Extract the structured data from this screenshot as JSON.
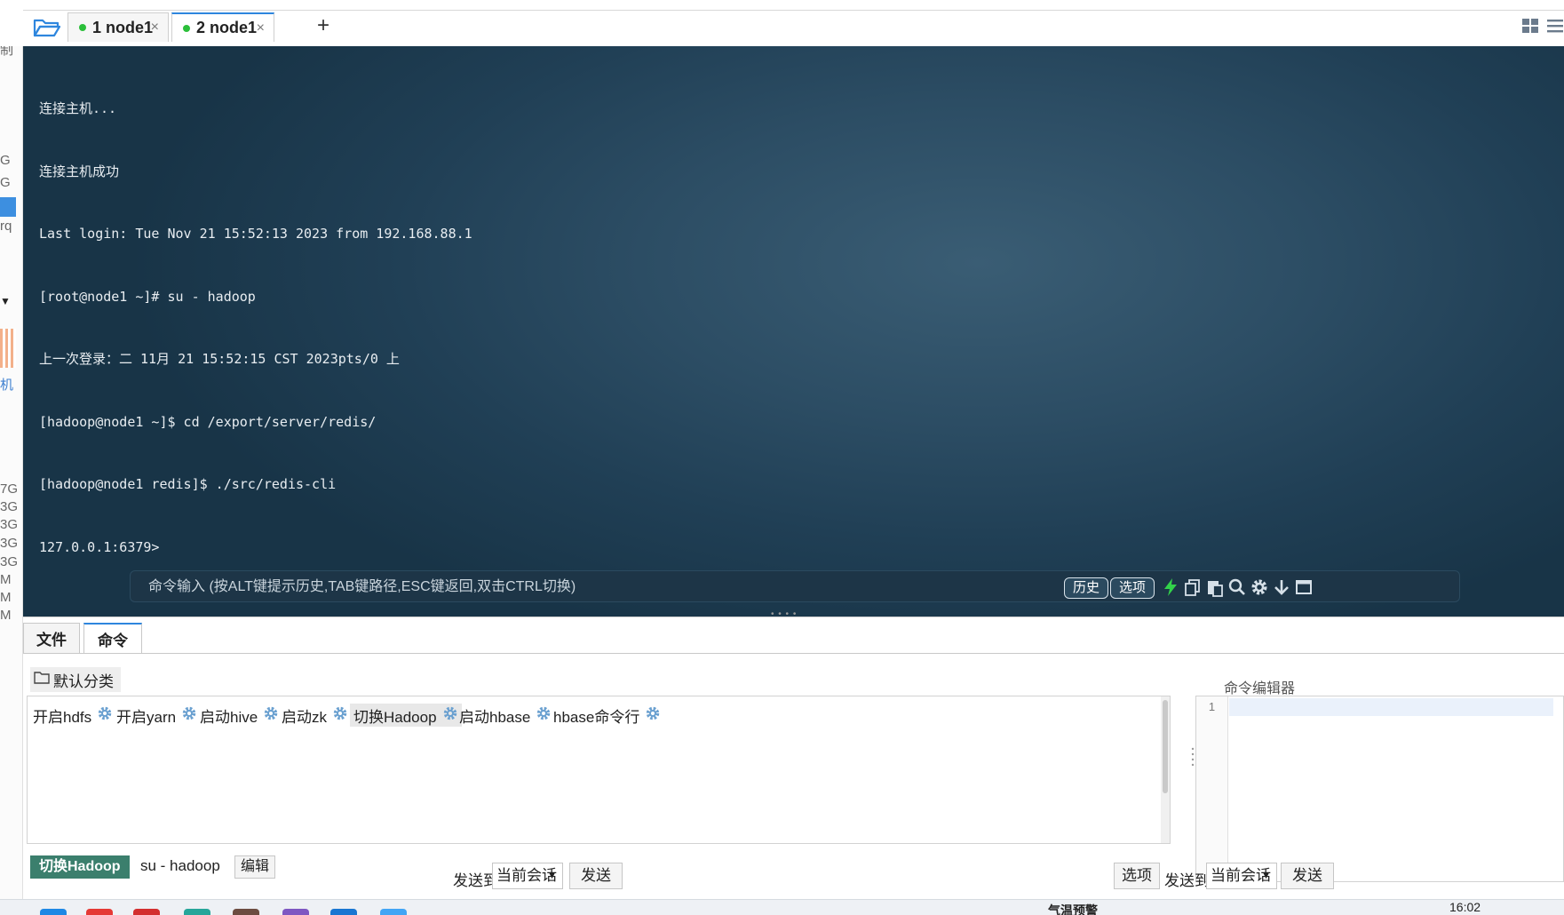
{
  "tabs": [
    {
      "label": "1 node1",
      "status_color": "#2bbf3a"
    },
    {
      "label": "2 node1",
      "status_color": "#2bbf3a"
    }
  ],
  "tab_close": "×",
  "add_tab": "+",
  "left_fragments": [
    "制",
    "G",
    "G",
    "rq",
    "机",
    "7G",
    "3G",
    "3G",
    "3G",
    "3G",
    "M",
    "M",
    "M"
  ],
  "terminal": {
    "lines": [
      "连接主机...",
      "连接主机成功",
      "Last login: Tue Nov 21 15:52:13 2023 from 192.168.88.1",
      "[root@node1 ~]# su - hadoop",
      "上一次登录：二 11月 21 15:52:15 CST 2023pts/0 上",
      "[hadoop@node1 ~]$ cd /export/server/redis/",
      "[hadoop@node1 redis]$ ./src/redis-cli",
      "127.0.0.1:6379>"
    ]
  },
  "cmdbar": {
    "placeholder": "命令输入 (按ALT键提示历史,TAB键路径,ESC键返回,双击CTRL切换)",
    "history_label": "历史",
    "options_label": "选项",
    "icons": [
      "lightning-icon",
      "copy-icon",
      "paste-icon",
      "search-icon",
      "gear-icon",
      "download-arrow-icon",
      "maximize-icon"
    ]
  },
  "bottom_tabs": [
    {
      "label": "文件"
    },
    {
      "label": "命令"
    }
  ],
  "category": {
    "label": "默认分类"
  },
  "quick_commands": [
    {
      "label": "开启hdfs"
    },
    {
      "label": "开启yarn"
    },
    {
      "label": "启动hive"
    },
    {
      "label": "启动zk"
    },
    {
      "label": "切换Hadoop"
    },
    {
      "label": "启动hbase"
    },
    {
      "label": "hbase命令行"
    }
  ],
  "selected_command": {
    "name": "切换Hadoop",
    "command": "su - hadoop",
    "edit_label": "编辑"
  },
  "editor": {
    "title": "命令编辑器",
    "line_number": "1",
    "content": ""
  },
  "send_left": {
    "label": "发送到",
    "target": "当前会话",
    "button": "发送"
  },
  "send_right": {
    "options": "选项",
    "label": "发送到",
    "target": "当前会话",
    "button": "发送"
  },
  "taskbar": {
    "clock": "16:02",
    "partial_text": "气温预警"
  },
  "colors": {
    "accent": "#2e86de",
    "status_green": "#2bbf3a",
    "selected_badge": "#3b7f6d",
    "terminal_bg": "#243f53"
  }
}
